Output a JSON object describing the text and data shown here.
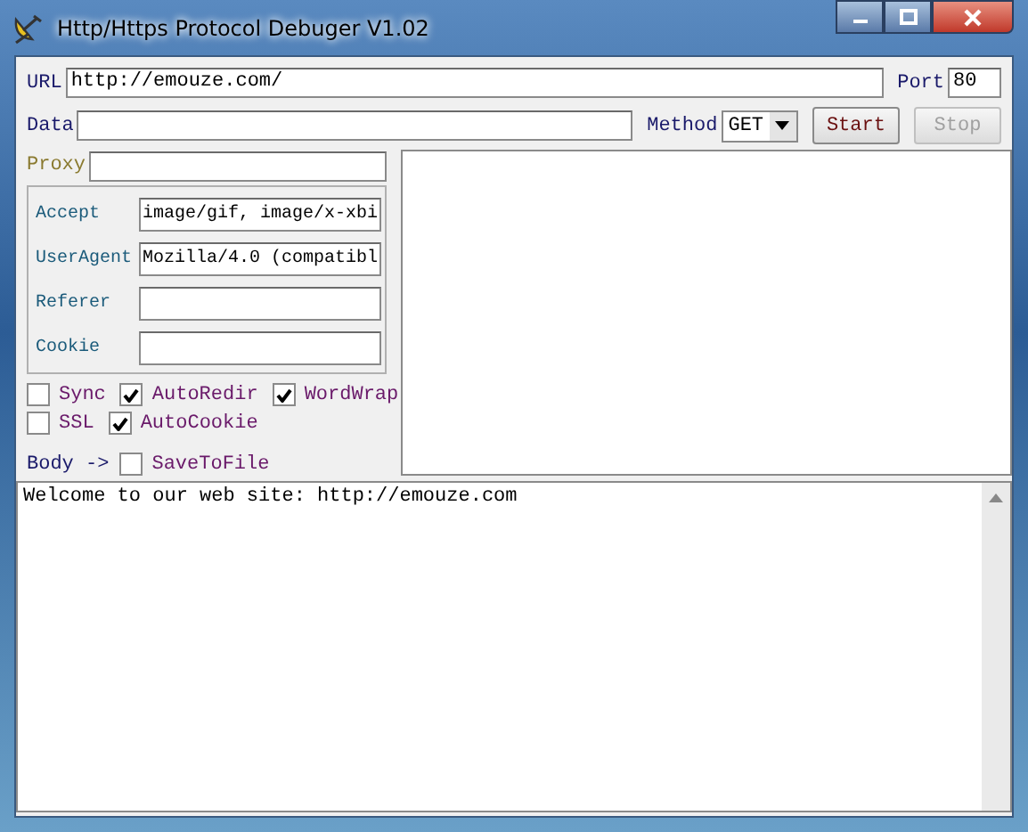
{
  "window": {
    "title": "Http/Https Protocol Debuger V1.02"
  },
  "url": {
    "label": "URL",
    "value": "http://emouze.com/"
  },
  "port": {
    "label": "Port",
    "value": "80"
  },
  "data": {
    "label": "Data"
  },
  "method": {
    "label": "Method",
    "value": "GET"
  },
  "buttons": [
    {
      "label": "Start",
      "disabled": false
    },
    {
      "label": "Stop",
      "disabled": true
    }
  ],
  "proxy": {
    "label": "Proxy",
    "disabled": true
  },
  "headers": [
    {
      "label": "Accept",
      "value": "image/gif, image/x-xbi"
    },
    {
      "label": "UserAgent",
      "value": "Mozilla/4.0 (compatibl"
    },
    {
      "label": "Referer"
    },
    {
      "label": "Cookie"
    }
  ],
  "options": [
    {
      "label": "Sync",
      "checked": false
    },
    {
      "label": "AutoRedir",
      "checked": true
    },
    {
      "label": "WordWrap",
      "checked": true
    },
    {
      "label": "SSL",
      "checked": false
    },
    {
      "label": "AutoCookie",
      "checked": true
    }
  ],
  "body": {
    "label": "Body ->"
  },
  "save_to_file": {
    "label": "SaveToFile",
    "checked": false
  },
  "output": {
    "text": "Welcome to our web site: http://emouze.com"
  }
}
